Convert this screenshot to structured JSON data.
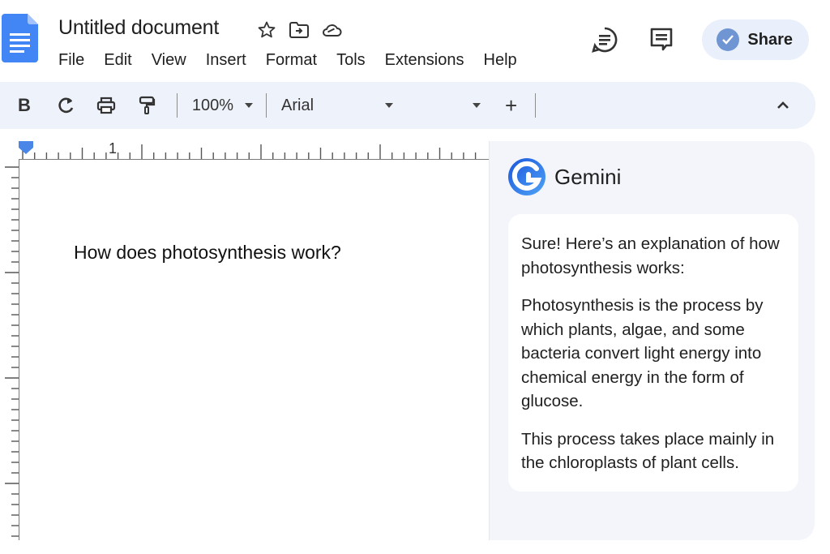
{
  "document": {
    "title": "Untitled document",
    "body_text": "How does photosynthesis work?"
  },
  "menu": [
    "File",
    "Edit",
    "View",
    "Insert",
    "Format",
    "Tols",
    "Extensions",
    "Help"
  ],
  "share": {
    "label": "Share"
  },
  "toolbar": {
    "bold_label": "B",
    "zoom": "100%",
    "font": "Arial",
    "ruler_mark": "1"
  },
  "gemini": {
    "title": "Gemini",
    "response": [
      "Sure! Here’s an explanation of how photosynthesis works:",
      "Photosynthesis is the process by which plants, algae, and some bacteria convert light energy into chemical energy in the form of glucose.",
      "This process takes place mainly in the chloroplasts of plant cells."
    ]
  },
  "colors": {
    "accent_blue": "#4285f4",
    "toolbar_bg": "#eef2fa",
    "panel_bg": "#f3f5fb",
    "share_bg": "#eaf0fb"
  },
  "icons": [
    "docs-logo-icon",
    "star-icon",
    "move-folder-icon",
    "cloud-saved-icon",
    "comment-history-icon",
    "comments-icon",
    "check-icon",
    "undo-icon",
    "print-icon",
    "paint-format-icon",
    "plus-icon",
    "chevron-up-icon",
    "gemini-logo-icon"
  ]
}
